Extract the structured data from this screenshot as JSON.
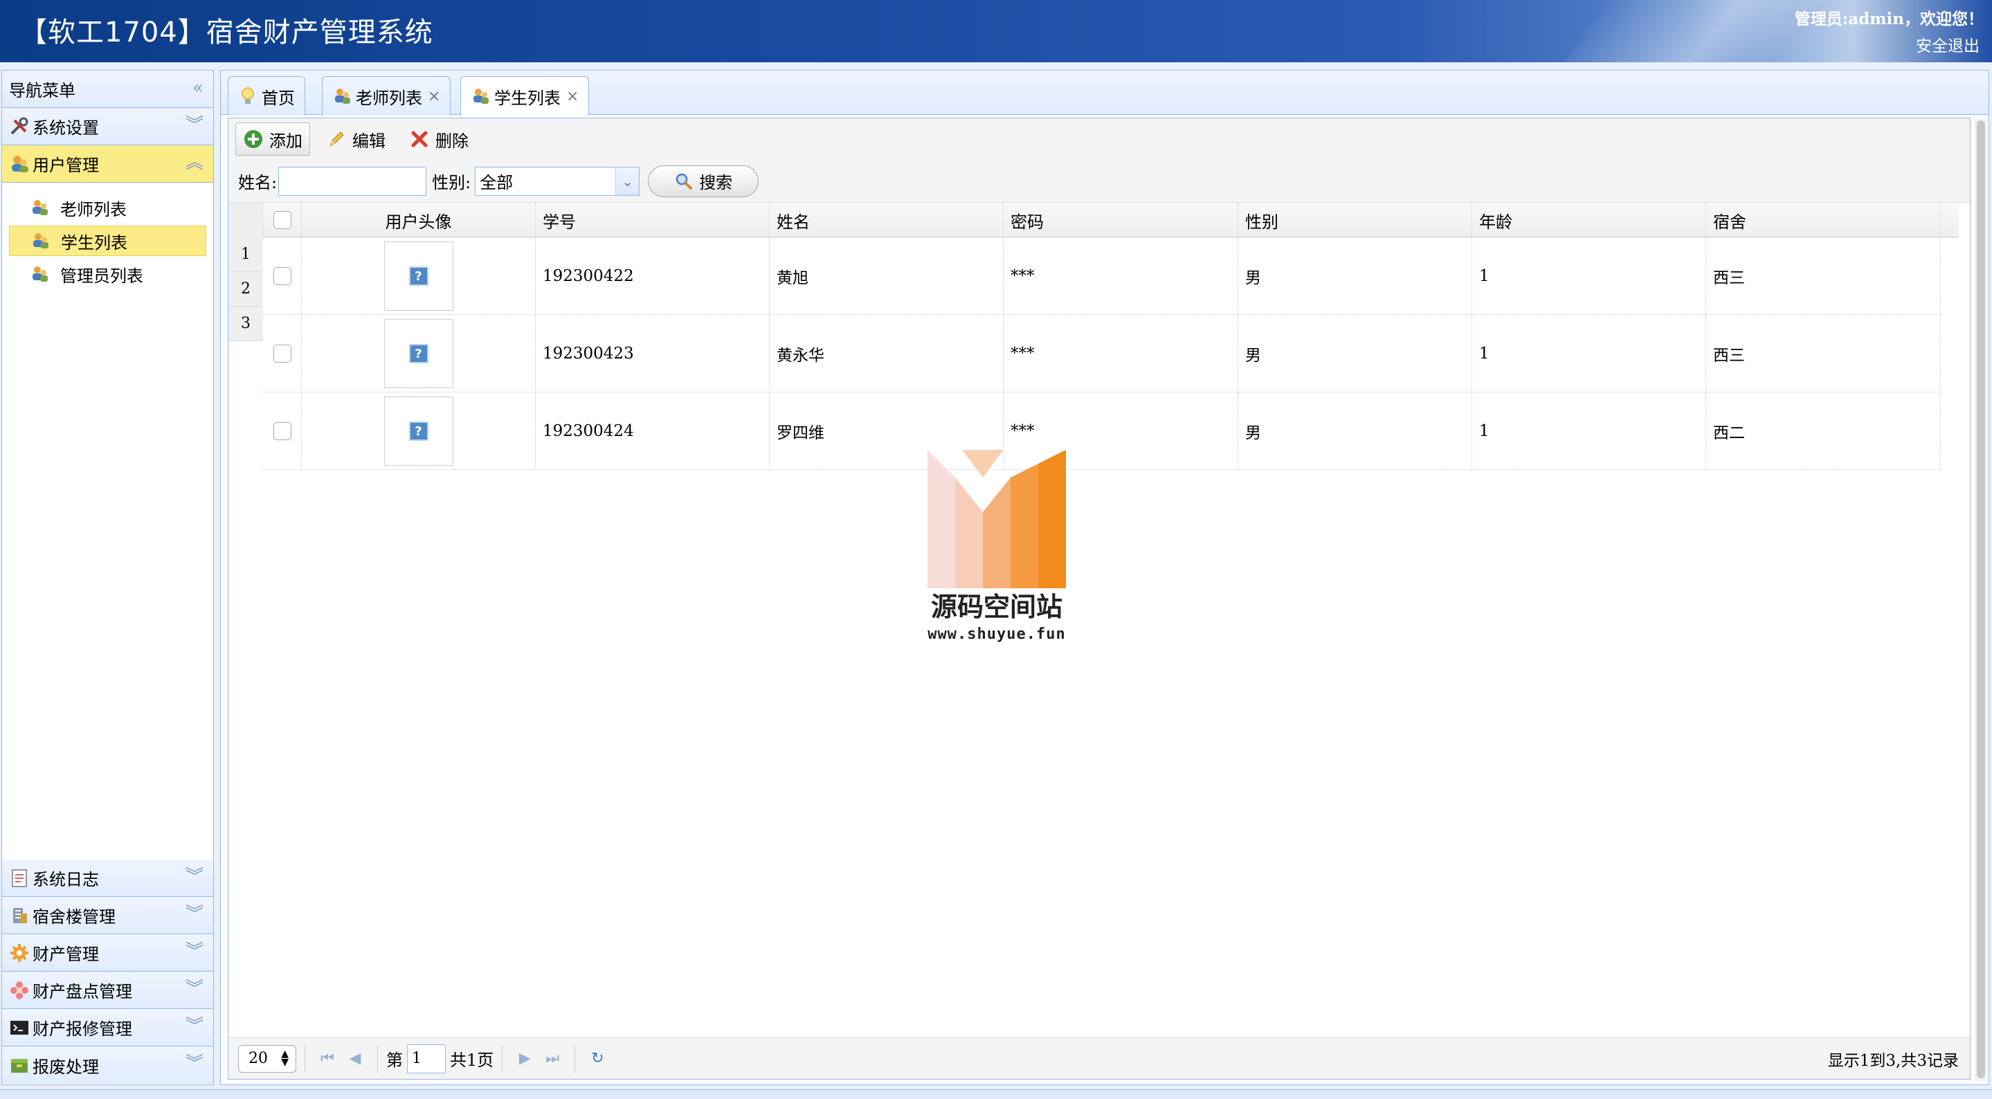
{
  "header": {
    "title": "【软工1704】宿舍财产管理系统",
    "welcome": "管理员:admin，欢迎您！",
    "logout": "安全退出"
  },
  "sidebar": {
    "nav_title": "导航菜单",
    "top_sections": [
      {
        "label": "系统设置",
        "icon": "tools-icon"
      },
      {
        "label": "用户管理",
        "icon": "users-icon"
      }
    ],
    "user_items": [
      {
        "label": "老师列表",
        "icon": "user-icon"
      },
      {
        "label": "学生列表",
        "icon": "user-icon"
      },
      {
        "label": "管理员列表",
        "icon": "user-icon"
      }
    ],
    "bottom_sections": [
      {
        "label": "系统日志",
        "icon": "log-icon"
      },
      {
        "label": "宿舍楼管理",
        "icon": "building-icon"
      },
      {
        "label": "财产管理",
        "icon": "gear-icon"
      },
      {
        "label": "财产盘点管理",
        "icon": "flower-icon"
      },
      {
        "label": "财产报修管理",
        "icon": "terminal-icon"
      },
      {
        "label": "报废处理",
        "icon": "box-icon"
      }
    ]
  },
  "tabs": [
    {
      "label": "首页",
      "icon": "bulb-icon",
      "closable": false
    },
    {
      "label": "老师列表",
      "icon": "user-icon",
      "closable": true
    },
    {
      "label": "学生列表",
      "icon": "user-icon",
      "closable": true
    }
  ],
  "toolbar": {
    "add": "添加",
    "edit": "编辑",
    "delete": "删除"
  },
  "search": {
    "name_label": "姓名:",
    "name_value": "",
    "gender_label": "性别:",
    "gender_value": "全部",
    "button": "搜索"
  },
  "grid": {
    "columns": [
      "用户头像",
      "学号",
      "姓名",
      "密码",
      "性别",
      "年龄",
      "宿舍"
    ],
    "row_numbers": [
      "1",
      "2",
      "3"
    ],
    "rows": [
      {
        "id": "192300422",
        "name": "黄旭",
        "password": "***",
        "gender": "男",
        "age": "1",
        "dorm": "西三"
      },
      {
        "id": "192300423",
        "name": "黄永华",
        "password": "***",
        "gender": "男",
        "age": "1",
        "dorm": "西三"
      },
      {
        "id": "192300424",
        "name": "罗四维",
        "password": "***",
        "gender": "男",
        "age": "1",
        "dorm": "西二"
      }
    ]
  },
  "pager": {
    "page_size": "20",
    "page_prefix": "第",
    "page_value": "1",
    "page_total": "共1页",
    "info": "显示1到3,共3记录"
  },
  "watermark": {
    "name": "源码空间站",
    "url": "www.shuyue.fun"
  },
  "colors": {
    "header_blue": "#1a4aa0",
    "panel_border": "#95b8e7",
    "selected_yellow": "#fbec88",
    "watermark_orange": "#f28a1c"
  }
}
